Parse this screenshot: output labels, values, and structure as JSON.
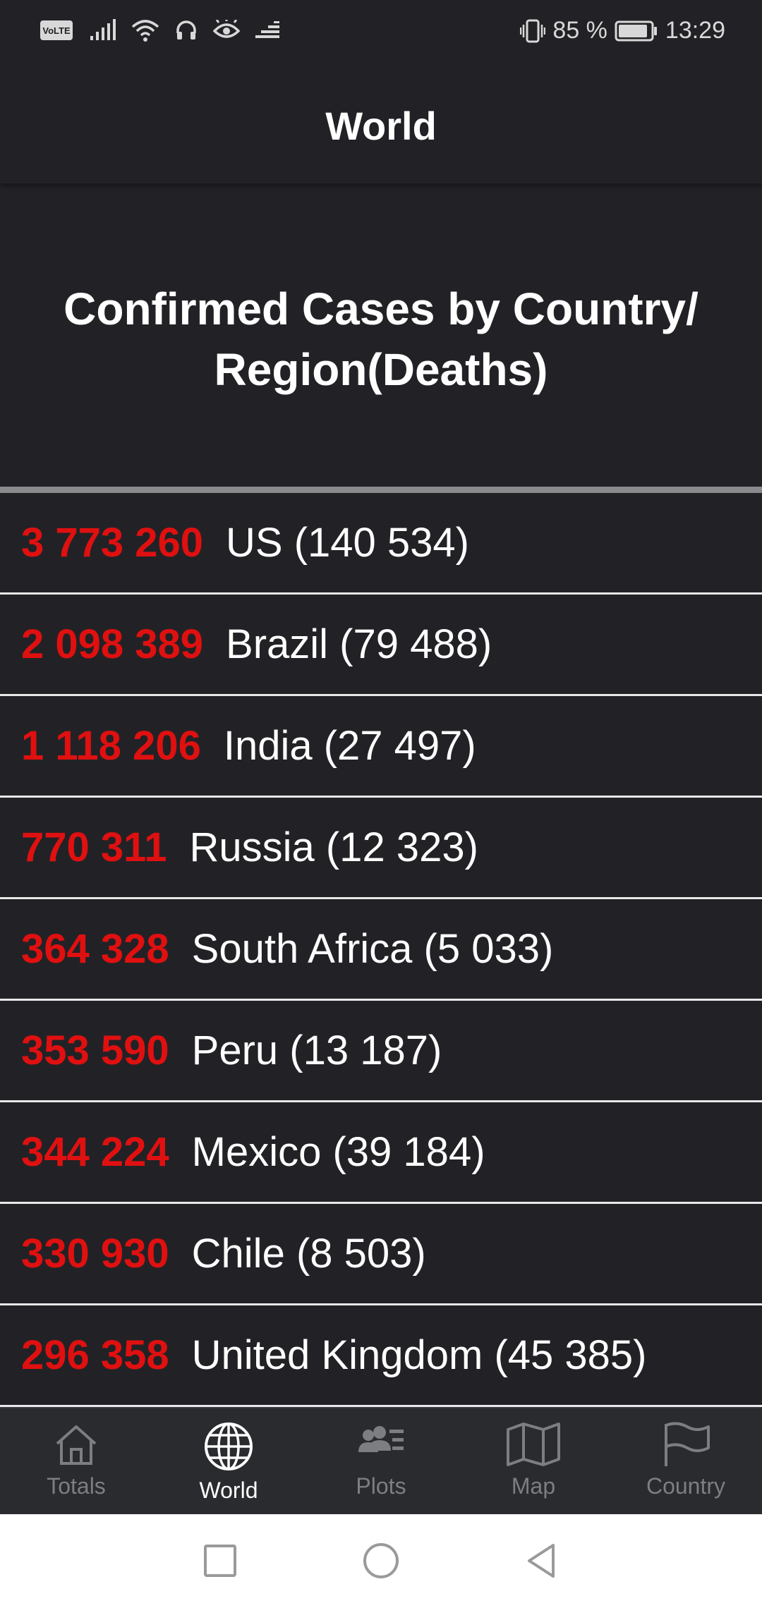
{
  "status_bar": {
    "volte": "VoLTE",
    "battery_text": "85 %",
    "time": "13:29"
  },
  "app_bar": {
    "title": "World"
  },
  "section": {
    "title": "Confirmed Cases by Country/ Region(Deaths)"
  },
  "rows": [
    {
      "cases": "3 773 260",
      "name": "US (140 534)"
    },
    {
      "cases": "2 098 389",
      "name": "Brazil (79 488)"
    },
    {
      "cases": "1 118 206",
      "name": "India (27 497)"
    },
    {
      "cases": "770 311",
      "name": "Russia (12 323)"
    },
    {
      "cases": "364 328",
      "name": "South Africa (5 033)"
    },
    {
      "cases": "353 590",
      "name": "Peru (13 187)"
    },
    {
      "cases": "344 224",
      "name": "Mexico (39 184)"
    },
    {
      "cases": "330 930",
      "name": "Chile (8 503)"
    },
    {
      "cases": "296 358",
      "name": "United Kingdom (45 385)"
    }
  ],
  "bottom_nav": {
    "items": [
      {
        "label": "Totals",
        "icon": "home-icon",
        "active": false
      },
      {
        "label": "World",
        "icon": "globe-icon",
        "active": true
      },
      {
        "label": "Plots",
        "icon": "people-list-icon",
        "active": false
      },
      {
        "label": "Map",
        "icon": "map-icon",
        "active": false
      },
      {
        "label": "Country",
        "icon": "flag-icon",
        "active": false
      }
    ]
  },
  "colors": {
    "background": "#222226",
    "accent_red": "#e01010",
    "nav_inactive": "#7d7e82",
    "nav_active": "#ffffff"
  }
}
